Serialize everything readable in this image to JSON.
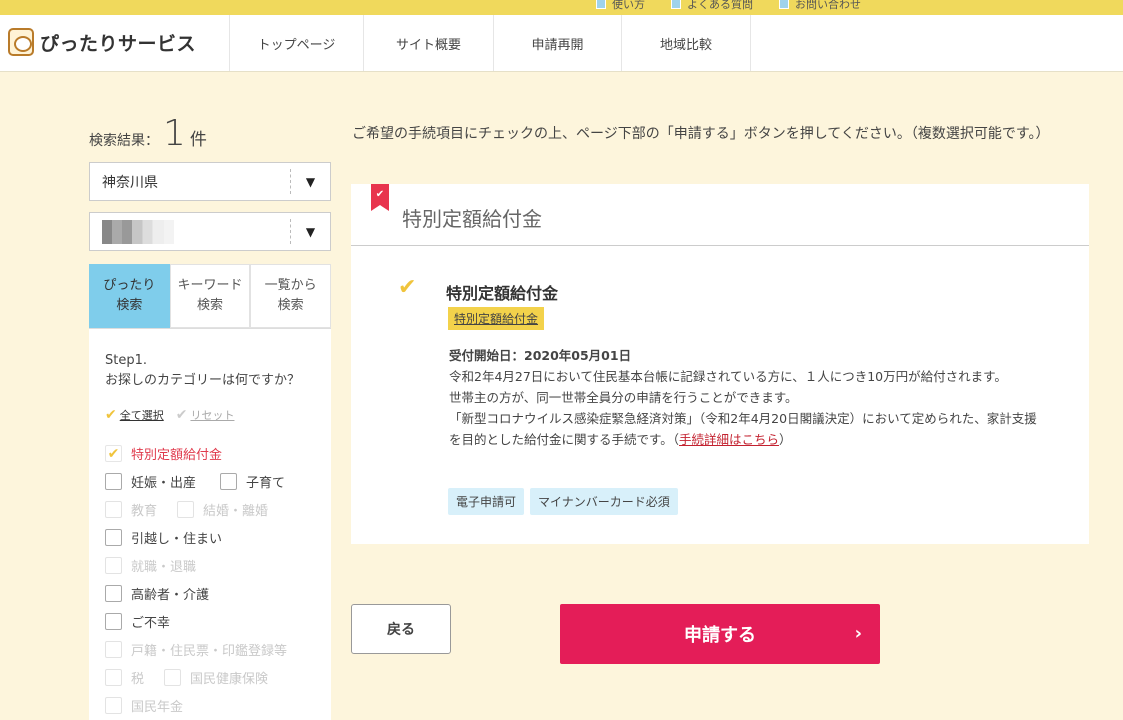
{
  "top_links": [
    "使い方",
    "よくある質問",
    "お問い合わせ"
  ],
  "logo_text": "ぴったりサービス",
  "nav": [
    "トップページ",
    "サイト概要",
    "申請再開",
    "地域比較"
  ],
  "search": {
    "result_label": "検索結果：",
    "count": "1",
    "unit": "件",
    "prefecture": "神奈川県",
    "arrow": "▼"
  },
  "tabs": [
    {
      "line1": "ぴったり",
      "line2": "検索"
    },
    {
      "line1": "キーワード",
      "line2": "検索"
    },
    {
      "line1": "一覧から",
      "line2": "検索"
    }
  ],
  "sidebar": {
    "step_title": "Step1.",
    "step_question": "お探しのカテゴリーは何ですか？",
    "select_all": "全て選択",
    "reset": "リセット",
    "categories": [
      {
        "label": "特別定額給付金"
      },
      {
        "label": "妊娠・出産"
      },
      {
        "label": "子育て"
      },
      {
        "label": "教育"
      },
      {
        "label": "結婚・離婚"
      },
      {
        "label": "引越し・住まい"
      },
      {
        "label": "就職・退職"
      },
      {
        "label": "高齢者・介護"
      },
      {
        "label": "ご不幸"
      },
      {
        "label": "戸籍・住民票・印鑑登録等"
      },
      {
        "label": "税"
      },
      {
        "label": "国民健康保険"
      },
      {
        "label": "国民年金"
      }
    ]
  },
  "main": {
    "instruction": "ご希望の手続項目にチェックの上、ページ下部の「申請する」ボタンを押してください。（複数選択可能です。）",
    "card_heading": "特別定額給付金",
    "procedure_title": "特別定額給付金",
    "procedure_tag": "特別定額給付金",
    "start_date": "受付開始日：2020年05月01日",
    "desc1": "令和2年4月27日において住民基本台帳に記録されている方に、１人につき10万円が給付されます。",
    "desc2": "世帯主の方が、同一世帯全員分の申請を行うことができます。",
    "desc3": "「新型コロナウイルス感染症緊急経済対策」（令和2年4月20日閣議決定）において定められた、家計支援を目的とした給付金に関する手続です。（",
    "detail_link": "手続詳細はこちら",
    "desc_close": "）",
    "tags": [
      "電子申請可",
      "マイナンバーカード必須"
    ]
  },
  "buttons": {
    "back": "戻る",
    "apply": "申請する",
    "apply_chevron": "›"
  },
  "colors": {
    "accent_yellow": "#f0d95c",
    "apply_pink": "#e41d58",
    "tab_blue": "#7fcdeb",
    "tag_blue": "#d8f0fa",
    "ribbon_red": "#e8344e",
    "background": "#fdf5dc"
  }
}
